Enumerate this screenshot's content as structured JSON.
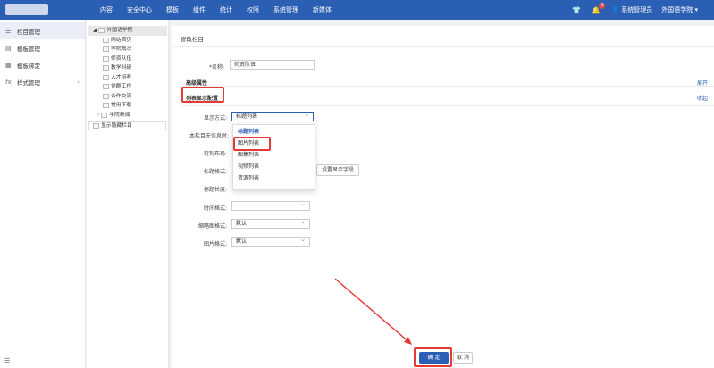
{
  "topbar": {
    "nav": [
      "内容",
      "安全中心",
      "模板",
      "组件",
      "统计",
      "权限",
      "系统管理",
      "新媒体"
    ],
    "notification_count": "8",
    "user": "系统管理员",
    "site": "外国语学院"
  },
  "leftnav": {
    "items": [
      {
        "icon": "list-icon",
        "label": "栏目管理"
      },
      {
        "icon": "template-icon",
        "label": "模板管理"
      },
      {
        "icon": "bind-icon",
        "label": "模板绑定"
      },
      {
        "icon": "fx-icon",
        "label": "样式管理"
      }
    ],
    "bottom_icon": "collapse-icon"
  },
  "tree": {
    "root": "外国语学院",
    "children": [
      "网站首页",
      "学院概况",
      "师资队伍",
      "教学科研",
      "人才培养",
      "党群工作",
      "合作交流",
      "常用下载",
      "学院新闻"
    ],
    "hidden": "显示隐藏栏目"
  },
  "form": {
    "title": "修改栏目",
    "name_label": "*名称:",
    "name_value": "师资队伍",
    "advanced": "高级属性",
    "expand": "展开",
    "list_config": "列表显示配置",
    "collapse": "收起",
    "display_mode_label": "显示方式:",
    "display_mode_value": "标题列表",
    "no_info_label": "本栏目无信息时:",
    "row_layout_label": "行列布局:",
    "title_format_label": "标题格式:",
    "set_fields_button": "设置显示字段",
    "title_length_label": "标题长度:",
    "time_format_label": "时间格式:",
    "thumb_format_label": "缩略图格式:",
    "thumb_format_value": "默认",
    "image_format_label": "图片格式:",
    "image_format_value": "默认",
    "dropdown_options": [
      "标题列表",
      "图片列表",
      "图集列表",
      "视频列表",
      "资源列表"
    ],
    "confirm": "确 定",
    "cancel": "取 消"
  },
  "colors": {
    "primary": "#2b5fb4",
    "highlight": "#e53935"
  }
}
